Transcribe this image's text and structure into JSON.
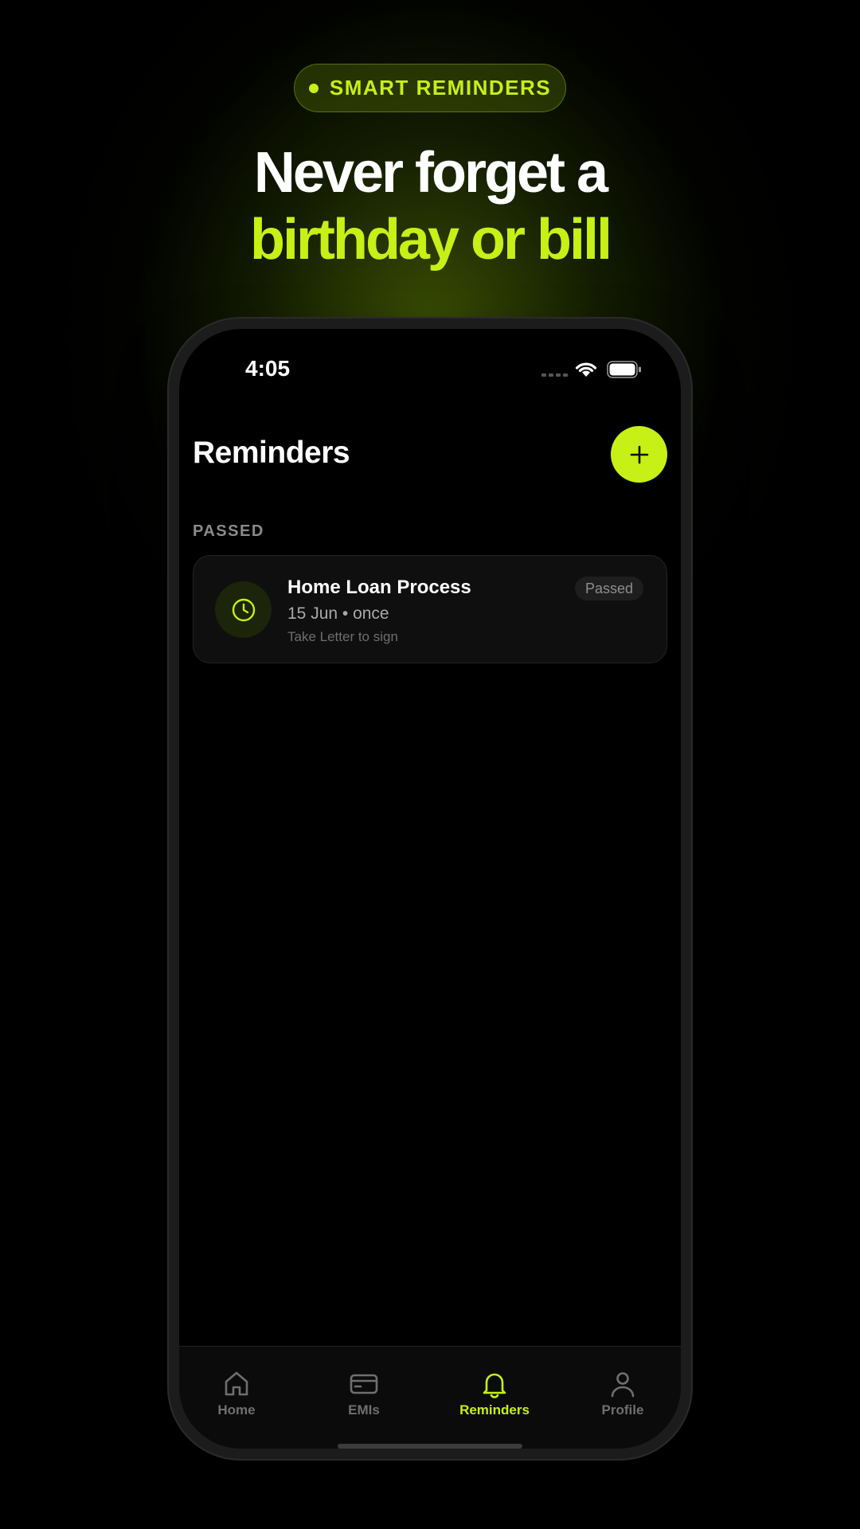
{
  "promo": {
    "badge": "SMART REMINDERS",
    "headline_line1": "Never forget a",
    "headline_line2": "birthday or bill"
  },
  "status_bar": {
    "time": "4:05"
  },
  "screen": {
    "title": "Reminders",
    "section_label": "PASSED",
    "reminders": [
      {
        "title": "Home Loan Process",
        "date": "15 Jun • once",
        "note": "Take Letter to sign",
        "status": "Passed"
      }
    ]
  },
  "tab_bar": {
    "items": [
      {
        "label": "Home",
        "icon": "home-icon",
        "active": false
      },
      {
        "label": "EMIs",
        "icon": "card-icon",
        "active": false
      },
      {
        "label": "Reminders",
        "icon": "bell-icon",
        "active": true
      },
      {
        "label": "Profile",
        "icon": "person-icon",
        "active": false
      }
    ]
  },
  "colors": {
    "accent": "#c6f016",
    "background": "#000000",
    "card": "#0f0f0f",
    "muted_text": "#8a8a8a"
  }
}
